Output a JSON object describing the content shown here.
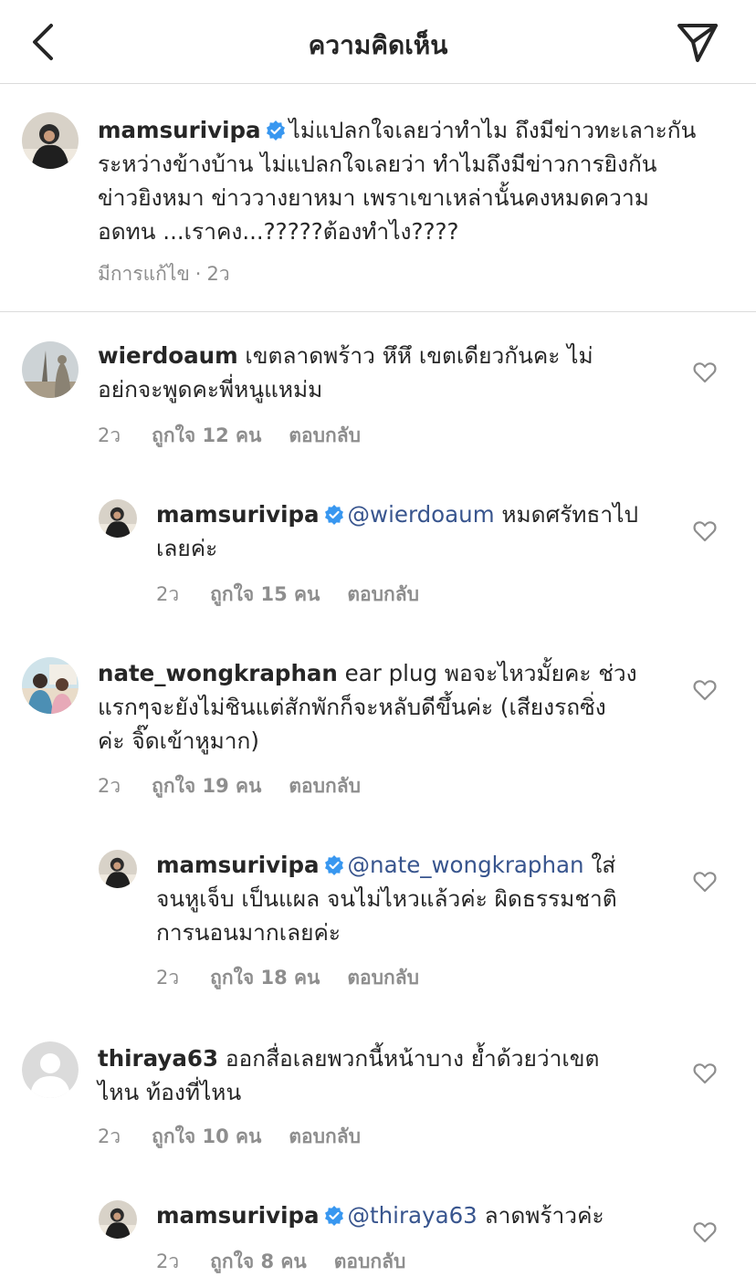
{
  "header": {
    "title": "ความคิดเห็น"
  },
  "caption": {
    "username": "mamsurivipa",
    "lines": [
      "ไม่แปลกใจเลยว่าทำไม ถึงมีข่าวทะเลาะกัน",
      "ระหว่างข้างบ้าน ไม่แปลกใจเลยว่า ทำไมถึงมีข่าวการยิงกัน",
      "ข่าวยิงหมา  ข่าววางยาหมา  เพราเขาเหล่านั้นคงหมดความ",
      "อดทน ...เราคง...?????ต้องทำไง????"
    ],
    "edited": "มีการแก้ไข",
    "separator": "·",
    "time": "2ว"
  },
  "comments": [
    {
      "username": "wierdoaum",
      "lines": [
        "เขตลาดพร้าว หึหึ เขตเดียวกันคะ ไม่",
        "อย่กจะพูดคะพี่หนูแหม่ม"
      ],
      "time": "2ว",
      "likes": "ถูกใจ 12 คน",
      "reply": "ตอบกลับ"
    },
    {
      "username": "mamsurivipa",
      "mention": "@wierdoaum",
      "lines": [
        "หมดศรัทธาไป",
        "เลยค่ะ"
      ],
      "time": "2ว",
      "likes": "ถูกใจ 15 คน",
      "reply": "ตอบกลับ"
    },
    {
      "username": "nate_wongkraphan",
      "lines": [
        "ear plug พอจะไหวมั้ยคะ ช่วง",
        "แรกๆจะยังไม่ชินแต่สักพักก็จะหลับดีขึ้นค่ะ (เสียงรถซิ่ง",
        "ค่ะ จิ๊ดเข้าหูมาก)"
      ],
      "time": "2ว",
      "likes": "ถูกใจ 19 คน",
      "reply": "ตอบกลับ"
    },
    {
      "username": "mamsurivipa",
      "mention": "@nate_wongkraphan",
      "lines": [
        "ใส่",
        "จนหูเจ็บ เป็นแผล จนไม่ไหวแล้วค่ะ ผิดธรรมชาติ",
        "การนอนมากเลยค่ะ"
      ],
      "time": "2ว",
      "likes": "ถูกใจ 18 คน",
      "reply": "ตอบกลับ"
    },
    {
      "username": "thiraya63",
      "lines": [
        "ออกสื่อเลยพวกนี้หน้าบาง ย้ำด้วยว่าเขต",
        "ไหน ท้องที่ไหน"
      ],
      "time": "2ว",
      "likes": "ถูกใจ 10 คน",
      "reply": "ตอบกลับ"
    },
    {
      "username": "mamsurivipa",
      "mention": "@thiraya63",
      "lines": [
        "ลาดพร้าวค่ะ"
      ],
      "time": "2ว",
      "likes": "ถูกใจ 8 คน",
      "reply": "ตอบกลับ"
    }
  ],
  "colors": {
    "text": "#262626",
    "secondary": "#8e8e8e",
    "mention": "#38558e",
    "verified": "#3897f0",
    "divider": "#dbdbdb"
  }
}
